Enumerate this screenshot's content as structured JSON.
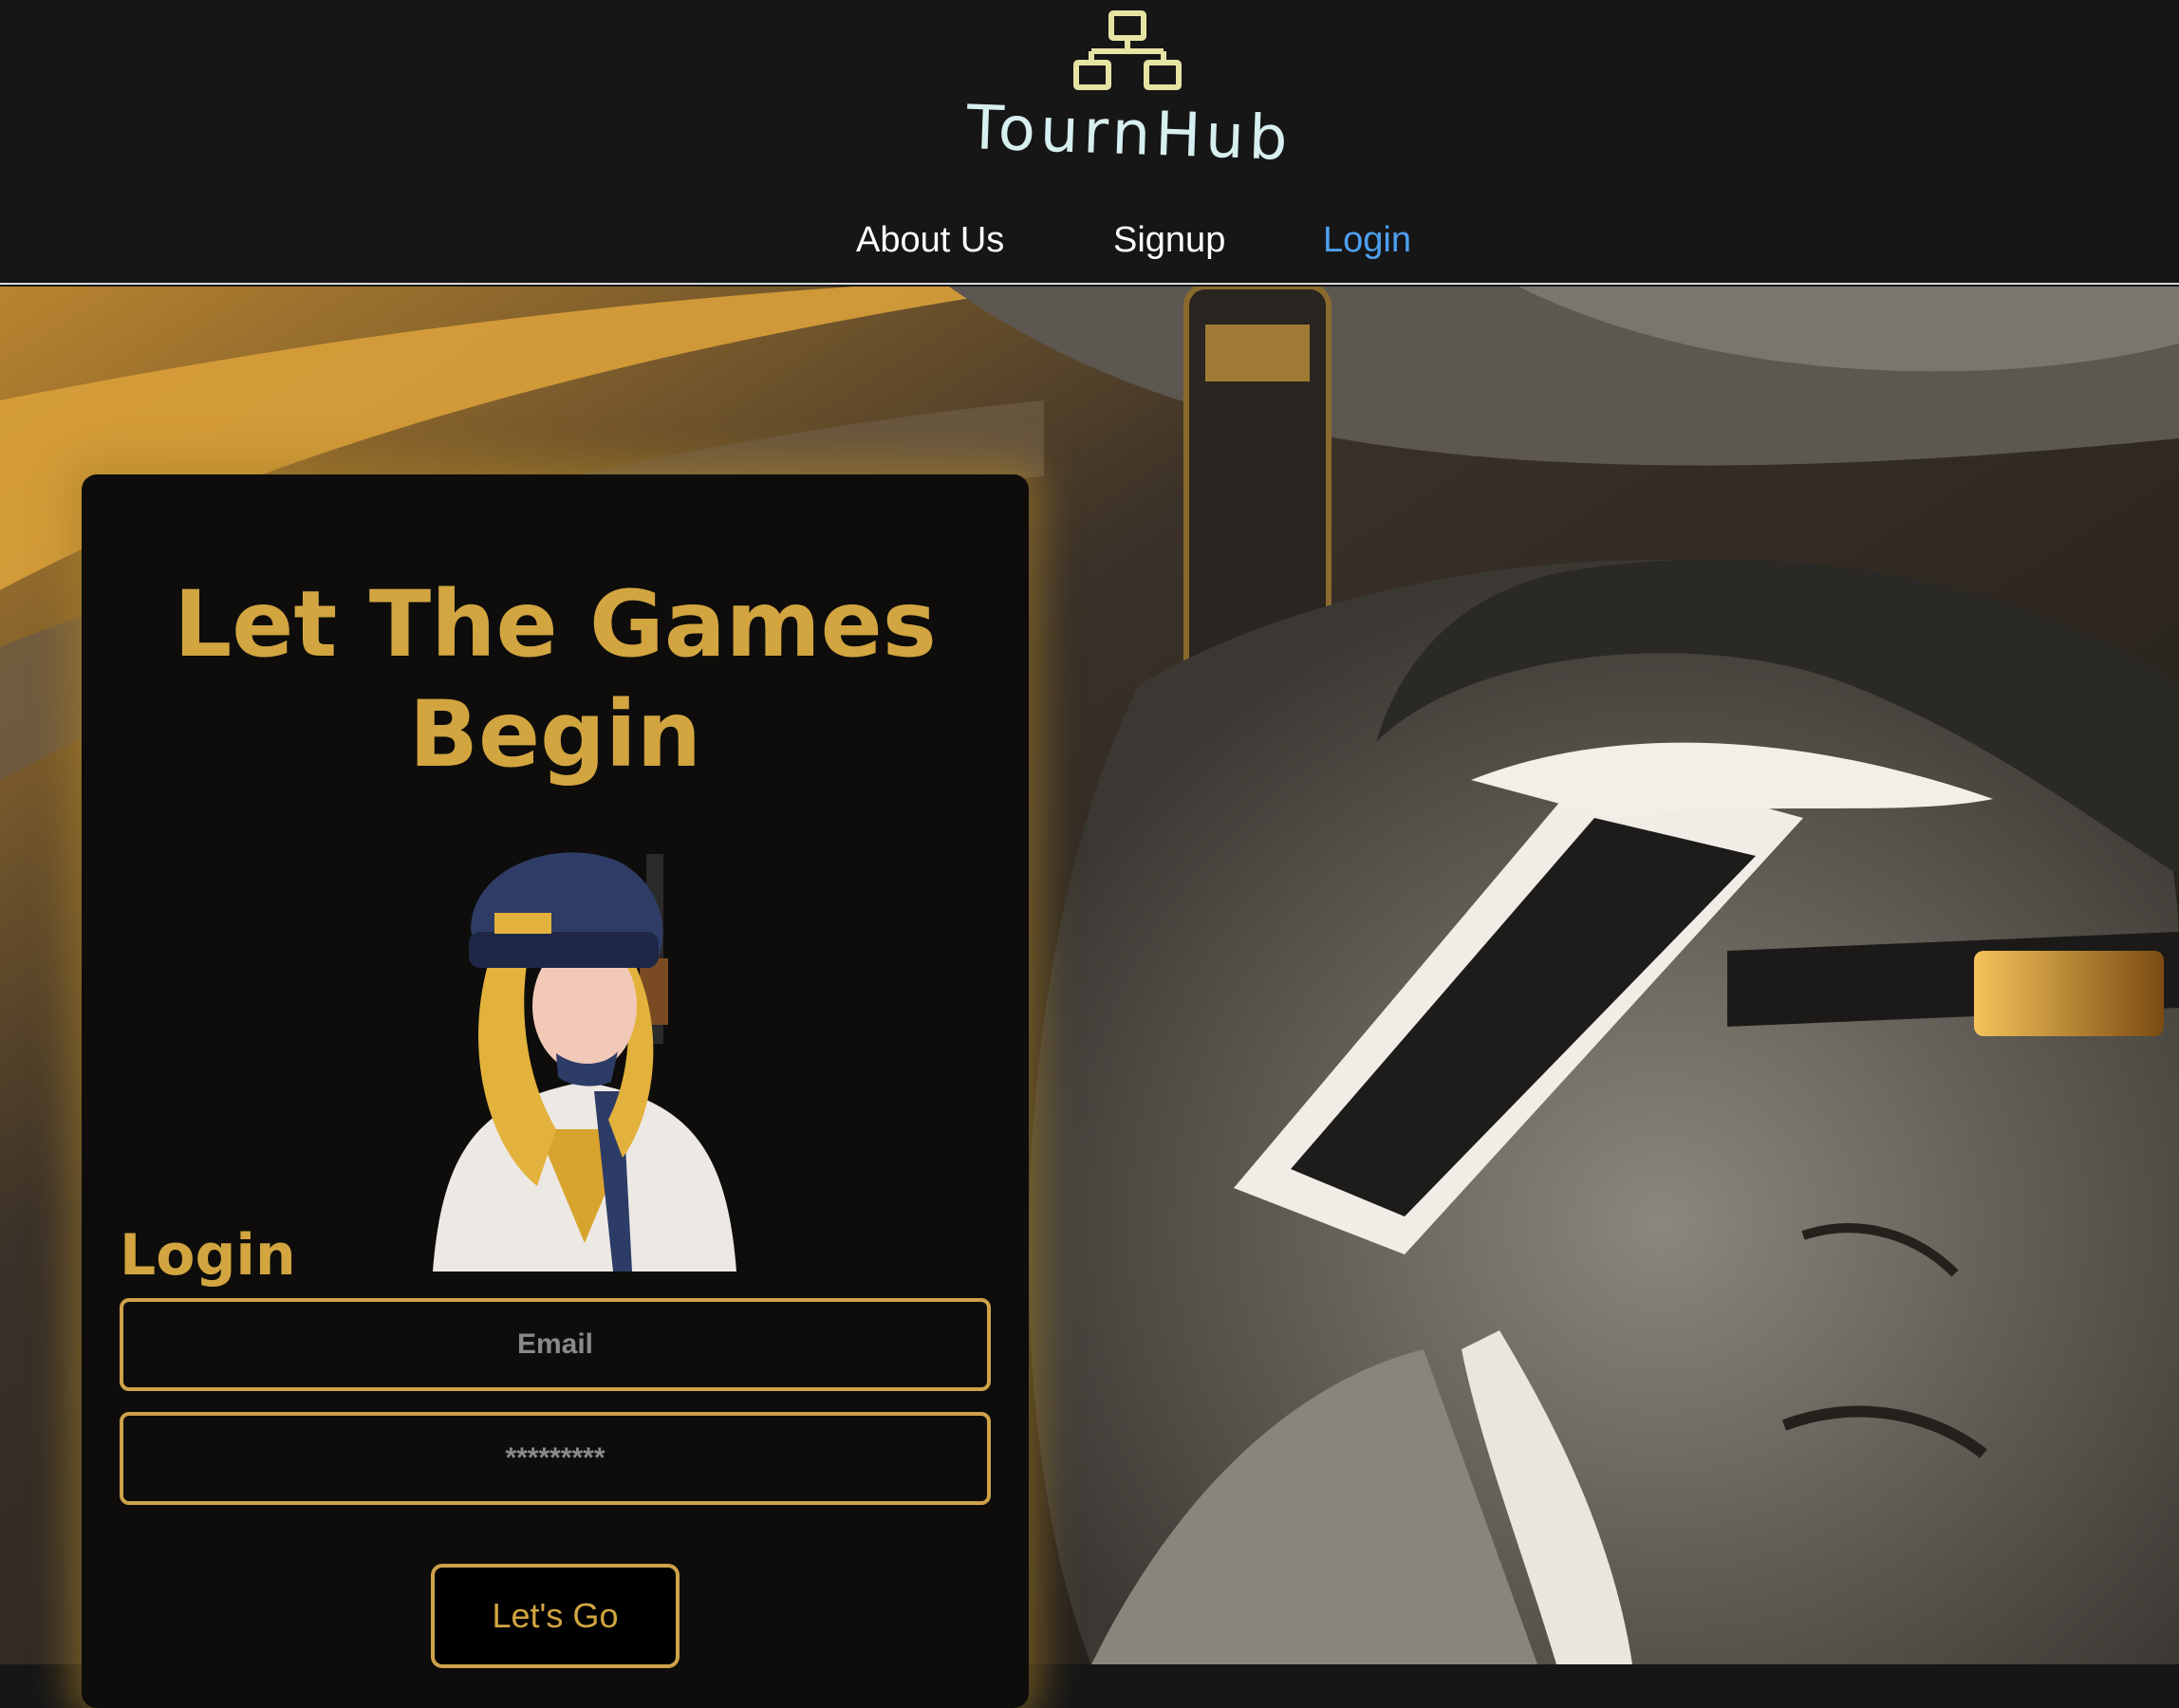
{
  "app": {
    "brand": "TournHub"
  },
  "nav": {
    "items": [
      {
        "label": "About Us",
        "active": false
      },
      {
        "label": "Signup",
        "active": false
      },
      {
        "label": "Login",
        "active": true
      }
    ]
  },
  "login_card": {
    "title_line1": "Let The Games",
    "title_line2": "Begin",
    "section_label": "Login",
    "email_placeholder": "Email",
    "password_placeholder": "*********",
    "submit_label": "Let's Go"
  },
  "colors": {
    "accent_gold": "#d2a540",
    "nav_active": "#4ea0ef",
    "header_bg": "#161617",
    "card_bg": "#0e0d0b"
  },
  "icons": {
    "logo": "network-hierarchy-icon"
  }
}
